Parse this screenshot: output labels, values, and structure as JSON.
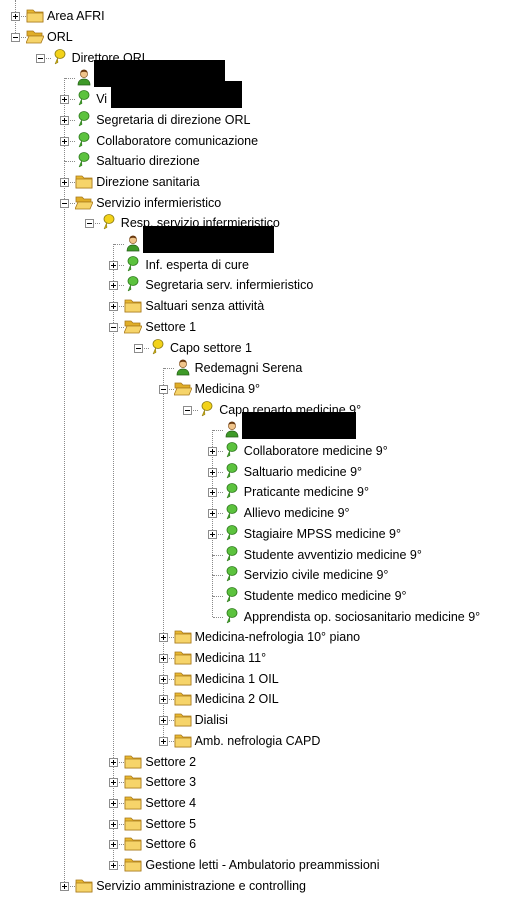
{
  "tree": [
    {
      "level": 0,
      "label": "Area AFRI",
      "icon": "folder-icon",
      "expander": "plus",
      "cut_top": true
    },
    {
      "level": 0,
      "label": "ORL",
      "icon": "folder-open-icon",
      "expander": "minus"
    },
    {
      "level": 1,
      "label": "Direttore ORL",
      "icon": "role-yellow-icon",
      "expander": "minus"
    },
    {
      "level": 2,
      "label": "",
      "icon": "person-icon",
      "expander": "none",
      "redacted": true
    },
    {
      "level": 2,
      "label": "Vi",
      "icon": "role-green-icon",
      "expander": "plus",
      "redacted": true
    },
    {
      "level": 2,
      "label": "Segretaria di direzione ORL",
      "icon": "role-green-icon",
      "expander": "plus"
    },
    {
      "level": 2,
      "label": "Collaboratore comunicazione",
      "icon": "role-green-icon",
      "expander": "plus"
    },
    {
      "level": 2,
      "label": "Saltuario direzione",
      "icon": "role-green-icon",
      "expander": "none"
    },
    {
      "level": 2,
      "label": "Direzione sanitaria",
      "icon": "folder-icon",
      "expander": "plus"
    },
    {
      "level": 2,
      "label": "Servizio infermieristico",
      "icon": "folder-open-icon",
      "expander": "minus"
    },
    {
      "level": 3,
      "label": "Resp. servizio infermieristico",
      "icon": "role-yellow-icon",
      "expander": "minus"
    },
    {
      "level": 4,
      "label": "",
      "icon": "person-icon",
      "expander": "none",
      "redacted": true
    },
    {
      "level": 4,
      "label": "Inf. esperta di cure",
      "icon": "role-green-icon",
      "expander": "plus"
    },
    {
      "level": 4,
      "label": "Segretaria serv. infermieristico",
      "icon": "role-green-icon",
      "expander": "plus"
    },
    {
      "level": 4,
      "label": "Saltuari senza attività",
      "icon": "folder-icon",
      "expander": "plus"
    },
    {
      "level": 4,
      "label": "Settore 1",
      "icon": "folder-open-icon",
      "expander": "minus"
    },
    {
      "level": 5,
      "label": "Capo settore 1",
      "icon": "role-yellow-icon",
      "expander": "minus"
    },
    {
      "level": 6,
      "label": "Redemagni Serena",
      "icon": "person-icon",
      "expander": "none"
    },
    {
      "level": 6,
      "label": "Medicina 9°",
      "icon": "folder-open-icon",
      "expander": "minus"
    },
    {
      "level": 7,
      "label": "Capo reparto medicine 9°",
      "icon": "role-yellow-icon",
      "expander": "minus"
    },
    {
      "level": 8,
      "label": "",
      "icon": "person-icon",
      "expander": "none",
      "redacted": true
    },
    {
      "level": 8,
      "label": "Collaboratore medicine 9°",
      "icon": "role-green-icon",
      "expander": "plus"
    },
    {
      "level": 8,
      "label": "Saltuario medicine 9°",
      "icon": "role-green-icon",
      "expander": "plus"
    },
    {
      "level": 8,
      "label": "Praticante medicine 9°",
      "icon": "role-green-icon",
      "expander": "plus"
    },
    {
      "level": 8,
      "label": "Allievo medicine 9°",
      "icon": "role-green-icon",
      "expander": "plus"
    },
    {
      "level": 8,
      "label": "Stagiaire MPSS medicine 9°",
      "icon": "role-green-icon",
      "expander": "plus"
    },
    {
      "level": 8,
      "label": "Studente avventizio medicine 9°",
      "icon": "role-green-icon",
      "expander": "none"
    },
    {
      "level": 8,
      "label": "Servizio civile medicine 9°",
      "icon": "role-green-icon",
      "expander": "none"
    },
    {
      "level": 8,
      "label": "Studente medico medicine 9°",
      "icon": "role-green-icon",
      "expander": "none"
    },
    {
      "level": 8,
      "label": "Apprendista op. sociosanitario medicine 9°",
      "icon": "role-green-icon",
      "expander": "none"
    },
    {
      "level": 6,
      "label": "Medicina-nefrologia 10° piano",
      "icon": "folder-icon",
      "expander": "plus"
    },
    {
      "level": 6,
      "label": "Medicina 11°",
      "icon": "folder-icon",
      "expander": "plus"
    },
    {
      "level": 6,
      "label": "Medicina 1 OIL",
      "icon": "folder-icon",
      "expander": "plus"
    },
    {
      "level": 6,
      "label": "Medicina 2 OIL",
      "icon": "folder-icon",
      "expander": "plus"
    },
    {
      "level": 6,
      "label": "Dialisi",
      "icon": "folder-icon",
      "expander": "plus"
    },
    {
      "level": 6,
      "label": "Amb. nefrologia CAPD",
      "icon": "folder-icon",
      "expander": "plus"
    },
    {
      "level": 4,
      "label": "Settore 2",
      "icon": "folder-icon",
      "expander": "plus"
    },
    {
      "level": 4,
      "label": "Settore 3",
      "icon": "folder-icon",
      "expander": "plus"
    },
    {
      "level": 4,
      "label": "Settore 4",
      "icon": "folder-icon",
      "expander": "plus"
    },
    {
      "level": 4,
      "label": "Settore 5",
      "icon": "folder-icon",
      "expander": "plus"
    },
    {
      "level": 4,
      "label": "Settore 6",
      "icon": "folder-icon",
      "expander": "plus"
    },
    {
      "level": 4,
      "label": "Gestione letti - Ambulatorio preammissioni",
      "icon": "folder-icon",
      "expander": "plus"
    },
    {
      "level": 2,
      "label": "Servizio amministrazione e controlling",
      "icon": "folder-icon",
      "expander": "plus",
      "cut_bottom": true
    }
  ]
}
